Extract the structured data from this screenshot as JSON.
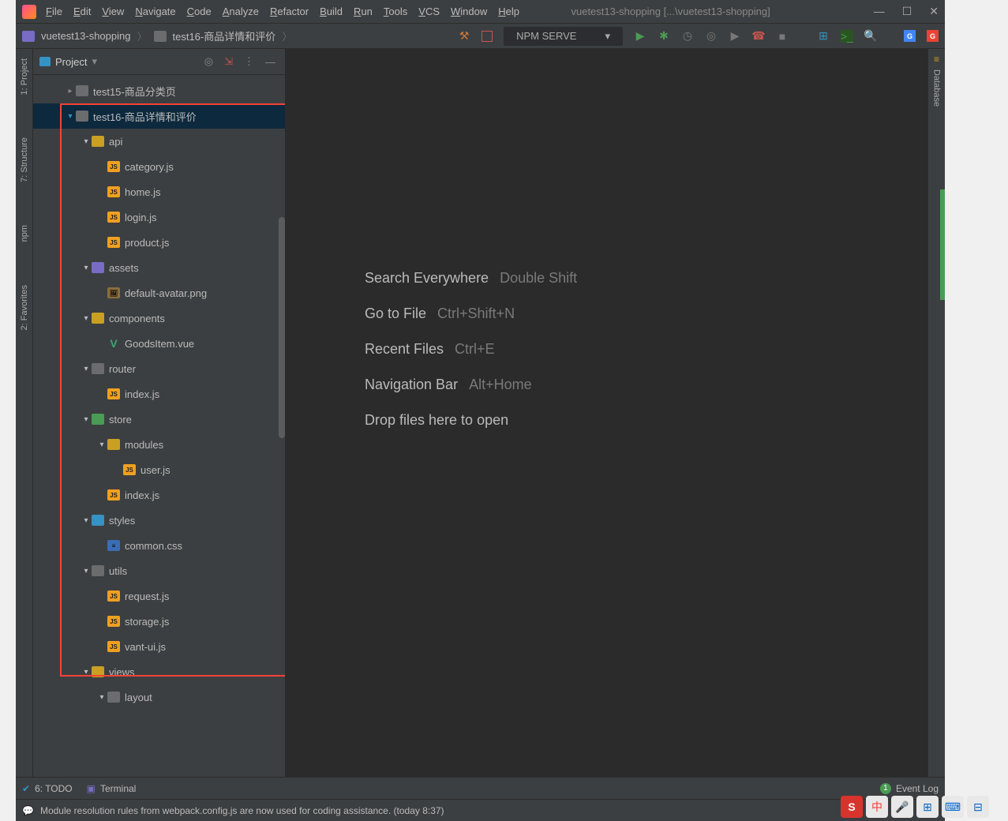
{
  "title": "vuetest13-shopping [...\\vuetest13-shopping]",
  "menus": [
    "File",
    "Edit",
    "View",
    "Navigate",
    "Code",
    "Analyze",
    "Refactor",
    "Build",
    "Run",
    "Tools",
    "VCS",
    "Window",
    "Help"
  ],
  "breadcrumb": {
    "project": "vuetest13-shopping",
    "path": "test16-商品详情和评价"
  },
  "runconfig": "NPM SERVE",
  "projectPanel": {
    "title": "Project"
  },
  "tree": [
    {
      "ind": 1,
      "arrow": ">",
      "icon": "grayf",
      "label": "test15-商品分类页",
      "sel": false
    },
    {
      "ind": 1,
      "arrow": "vs",
      "icon": "grayf",
      "label": "test16-商品详情和评价",
      "sel": true
    },
    {
      "ind": 2,
      "arrow": "v",
      "icon": "yellowf",
      "label": "api"
    },
    {
      "ind": 3,
      "arrow": "",
      "icon": "js",
      "label": "category.js"
    },
    {
      "ind": 3,
      "arrow": "",
      "icon": "js",
      "label": "home.js"
    },
    {
      "ind": 3,
      "arrow": "",
      "icon": "js",
      "label": "login.js"
    },
    {
      "ind": 3,
      "arrow": "",
      "icon": "js",
      "label": "product.js"
    },
    {
      "ind": 2,
      "arrow": "v",
      "icon": "folder",
      "label": "assets"
    },
    {
      "ind": 3,
      "arrow": "",
      "icon": "img",
      "label": "default-avatar.png"
    },
    {
      "ind": 2,
      "arrow": "v",
      "icon": "yellowf",
      "label": "components"
    },
    {
      "ind": 3,
      "arrow": "",
      "icon": "vue",
      "label": "GoodsItem.vue"
    },
    {
      "ind": 2,
      "arrow": "v",
      "icon": "grayf",
      "label": "router"
    },
    {
      "ind": 3,
      "arrow": "",
      "icon": "js",
      "label": "index.js"
    },
    {
      "ind": 2,
      "arrow": "v",
      "icon": "greenf",
      "label": "store"
    },
    {
      "ind": 3,
      "arrow": "v",
      "icon": "yellowf",
      "label": "modules"
    },
    {
      "ind": 4,
      "arrow": "",
      "icon": "js",
      "label": "user.js"
    },
    {
      "ind": 3,
      "arrow": "",
      "icon": "js",
      "label": "index.js"
    },
    {
      "ind": 2,
      "arrow": "v",
      "icon": "bluef",
      "label": "styles"
    },
    {
      "ind": 3,
      "arrow": "",
      "icon": "css",
      "label": "common.css"
    },
    {
      "ind": 2,
      "arrow": "v",
      "icon": "grayf",
      "label": "utils"
    },
    {
      "ind": 3,
      "arrow": "",
      "icon": "js",
      "label": "request.js"
    },
    {
      "ind": 3,
      "arrow": "",
      "icon": "js",
      "label": "storage.js"
    },
    {
      "ind": 3,
      "arrow": "",
      "icon": "js",
      "label": "vant-ui.js"
    },
    {
      "ind": 2,
      "arrow": "v",
      "icon": "yellowf",
      "label": "views"
    },
    {
      "ind": 3,
      "arrow": "v",
      "icon": "grayf",
      "label": "layout"
    }
  ],
  "welcome": [
    {
      "label": "Search Everywhere",
      "key": "Double Shift"
    },
    {
      "label": "Go to File",
      "key": "Ctrl+Shift+N"
    },
    {
      "label": "Recent Files",
      "key": "Ctrl+E"
    },
    {
      "label": "Navigation Bar",
      "key": "Alt+Home"
    },
    {
      "label": "Drop files here to open",
      "key": ""
    }
  ],
  "leftTabs": [
    "1: Project",
    "7: Structure",
    "npm",
    "2: Favorites"
  ],
  "rightTabs": [
    "Database"
  ],
  "bottom": {
    "todo": "6: TODO",
    "terminal": "Terminal",
    "eventlog": "Event Log",
    "eventCount": "1"
  },
  "status": "Module resolution rules from webpack.config.js are now used for coding assistance. (today 8:37)",
  "ime": "中"
}
